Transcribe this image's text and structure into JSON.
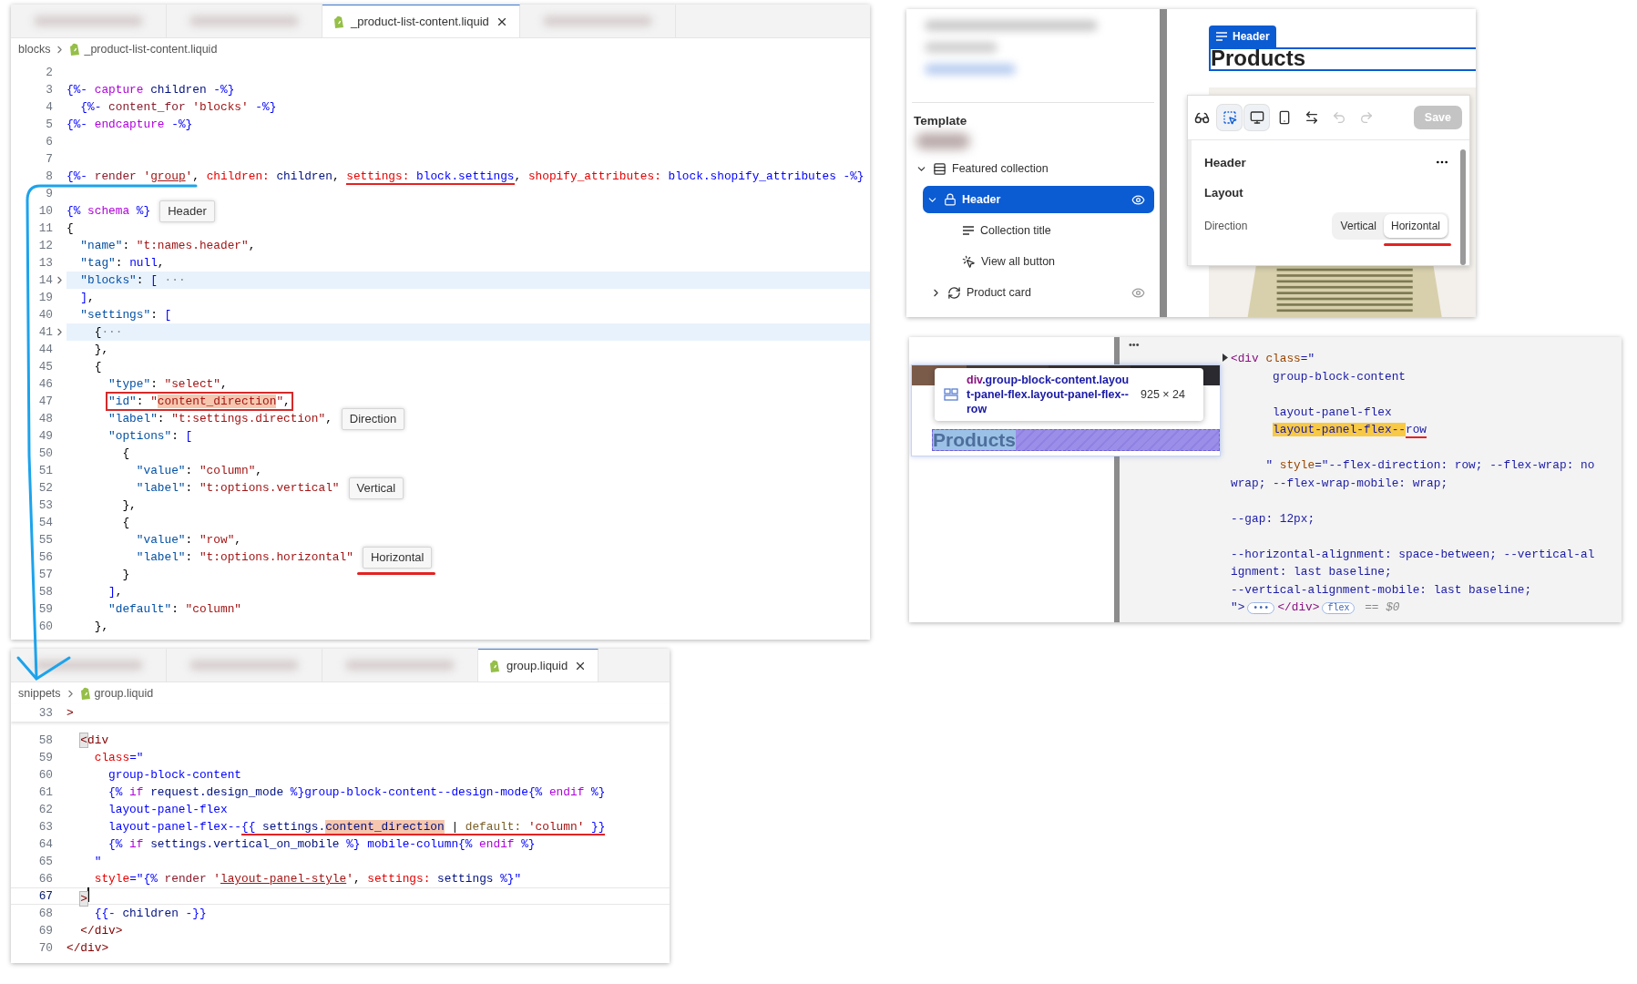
{
  "code_editors": [
    {
      "tabs": [
        {
          "kind": "blurred",
          "selected": false
        },
        {
          "kind": "blurred",
          "selected": false
        },
        {
          "kind": "file",
          "label": "_product-list-content.liquid",
          "selected": true
        },
        {
          "kind": "blurred",
          "selected": false
        }
      ],
      "breadcrumb": [
        "blocks",
        "_product-list-content.liquid"
      ],
      "lines": [
        {
          "n": "2"
        },
        {
          "n": "3",
          "tokens": [
            {
              "text": "{%-",
              "kind": "delimiter"
            },
            {
              "text": " capture",
              "kind": "keyword"
            },
            {
              "text": " children",
              "kind": "variable"
            },
            {
              "text": " -%}",
              "kind": "delimiter"
            }
          ]
        },
        {
          "n": "4",
          "tokens": [
            {
              "text": "  {%-",
              "kind": "delimiter"
            },
            {
              "text": " content_for",
              "kind": "tag"
            },
            {
              "text": " 'blocks'",
              "kind": "string"
            },
            {
              "text": " -%}",
              "kind": "delimiter"
            }
          ]
        },
        {
          "n": "5",
          "tokens": [
            {
              "text": "{%-",
              "kind": "delimiter"
            },
            {
              "text": " endcapture",
              "kind": "keyword"
            },
            {
              "text": " -%}",
              "kind": "delimiter"
            }
          ]
        },
        {
          "n": "6"
        },
        {
          "n": "7"
        },
        {
          "n": "8",
          "tokens": [
            {
              "text": "{%-",
              "kind": "delimiter"
            },
            {
              "text": " render ",
              "kind": "tag"
            },
            {
              "text": "'",
              "kind": "string"
            },
            {
              "text": "group",
              "kind": "string",
              "underlined": true
            },
            {
              "text": "'",
              "kind": "string"
            },
            {
              "text": ", ",
              "kind": "plain"
            },
            {
              "text": "children:",
              "kind": "attribute"
            },
            {
              "text": " children",
              "kind": "variable"
            },
            {
              "text": ", ",
              "kind": "plain"
            },
            {
              "text": "settings: ",
              "kind": "attribute",
              "annotated": true
            },
            {
              "text": "block.settings",
              "kind": "literal",
              "annotated": true
            },
            {
              "text": ", ",
              "kind": "plain"
            },
            {
              "text": "shopify_attributes:",
              "kind": "attribute"
            },
            {
              "text": " block.shopify_attributes",
              "kind": "literal"
            },
            {
              "text": " -%}",
              "kind": "delimiter"
            }
          ]
        },
        {
          "n": "9"
        },
        {
          "n": "10",
          "tokens": [
            {
              "text": "{%",
              "kind": "delimiter"
            },
            {
              "text": " schema",
              "kind": "keyword"
            },
            {
              "text": " %}",
              "kind": "delimiter"
            }
          ],
          "callout": {
            "text": "Header"
          }
        },
        {
          "n": "11",
          "tokens": [
            {
              "text": "{",
              "kind": "plain"
            }
          ]
        },
        {
          "n": "12",
          "tokens": [
            {
              "text": "  \"name\"",
              "kind": "key"
            },
            {
              "text": ": ",
              "kind": "plain"
            },
            {
              "text": "\"t:names.header\"",
              "kind": "string"
            },
            {
              "text": ",",
              "kind": "plain"
            }
          ]
        },
        {
          "n": "13",
          "tokens": [
            {
              "text": "  \"tag\"",
              "kind": "key"
            },
            {
              "text": ": ",
              "kind": "plain"
            },
            {
              "text": "null",
              "kind": "literal"
            },
            {
              "text": ",",
              "kind": "plain"
            }
          ]
        },
        {
          "n": "14",
          "folded": true,
          "tokens": [
            {
              "text": "  \"blocks\"",
              "kind": "key"
            },
            {
              "text": ": ",
              "kind": "plain"
            },
            {
              "text": "[",
              "kind": "literal"
            },
            {
              "text": " ···",
              "kind": "folded"
            }
          ]
        },
        {
          "n": "19",
          "tokens": [
            {
              "text": "  ]",
              "kind": "literal"
            },
            {
              "text": ",",
              "kind": "plain"
            }
          ]
        },
        {
          "n": "40",
          "tokens": [
            {
              "text": "  \"settings\"",
              "kind": "key"
            },
            {
              "text": ": ",
              "kind": "plain"
            },
            {
              "text": "[",
              "kind": "literal"
            }
          ]
        },
        {
          "n": "41",
          "folded": true,
          "tokens": [
            {
              "text": "    {",
              "kind": "plain"
            },
            {
              "text": "···",
              "kind": "folded"
            }
          ]
        },
        {
          "n": "44",
          "tokens": [
            {
              "text": "    },",
              "kind": "plain"
            }
          ]
        },
        {
          "n": "45",
          "tokens": [
            {
              "text": "    {",
              "kind": "plain"
            }
          ]
        },
        {
          "n": "46",
          "tokens": [
            {
              "text": "      \"type\"",
              "kind": "key"
            },
            {
              "text": ": ",
              "kind": "plain"
            },
            {
              "text": "\"select\"",
              "kind": "string"
            },
            {
              "text": ",",
              "kind": "plain"
            }
          ]
        },
        {
          "n": "47",
          "boxed": true,
          "tokens": [
            {
              "text": "      \"id\"",
              "kind": "key"
            },
            {
              "text": ": ",
              "kind": "plain"
            },
            {
              "text": "\"",
              "kind": "string"
            },
            {
              "text": "content_direction",
              "kind": "string",
              "highlighted": true
            },
            {
              "text": "\"",
              "kind": "string"
            },
            {
              "text": ",",
              "kind": "plain"
            }
          ]
        },
        {
          "n": "48",
          "tokens": [
            {
              "text": "      \"label\"",
              "kind": "key"
            },
            {
              "text": ": ",
              "kind": "plain"
            },
            {
              "text": "\"t:settings.direction\"",
              "kind": "string"
            },
            {
              "text": ",",
              "kind": "plain"
            }
          ],
          "callout": {
            "text": "Direction"
          }
        },
        {
          "n": "49",
          "tokens": [
            {
              "text": "      \"options\"",
              "kind": "key"
            },
            {
              "text": ": ",
              "kind": "plain"
            },
            {
              "text": "[",
              "kind": "literal"
            }
          ]
        },
        {
          "n": "50",
          "tokens": [
            {
              "text": "        {",
              "kind": "plain"
            }
          ]
        },
        {
          "n": "51",
          "tokens": [
            {
              "text": "          \"value\"",
              "kind": "key"
            },
            {
              "text": ": ",
              "kind": "plain"
            },
            {
              "text": "\"column\"",
              "kind": "string"
            },
            {
              "text": ",",
              "kind": "plain"
            }
          ]
        },
        {
          "n": "52",
          "tokens": [
            {
              "text": "          \"label\"",
              "kind": "key"
            },
            {
              "text": ": ",
              "kind": "plain"
            },
            {
              "text": "\"t:options.vertical\"",
              "kind": "string"
            }
          ],
          "callout": {
            "text": "Vertical"
          }
        },
        {
          "n": "53",
          "tokens": [
            {
              "text": "        },",
              "kind": "plain"
            }
          ]
        },
        {
          "n": "54",
          "tokens": [
            {
              "text": "        {",
              "kind": "plain"
            }
          ]
        },
        {
          "n": "55",
          "tokens": [
            {
              "text": "          \"value\"",
              "kind": "key"
            },
            {
              "text": ": ",
              "kind": "plain"
            },
            {
              "text": "\"row\"",
              "kind": "string"
            },
            {
              "text": ",",
              "kind": "plain"
            }
          ]
        },
        {
          "n": "56",
          "tokens": [
            {
              "text": "          \"label\"",
              "kind": "key"
            },
            {
              "text": ": ",
              "kind": "plain"
            },
            {
              "text": "\"t:options.horizontal\"",
              "kind": "string"
            }
          ],
          "callout": {
            "text": "Horizontal",
            "marked": true
          }
        },
        {
          "n": "57",
          "tokens": [
            {
              "text": "        }",
              "kind": "plain"
            }
          ]
        },
        {
          "n": "58",
          "tokens": [
            {
              "text": "      ]",
              "kind": "literal"
            },
            {
              "text": ",",
              "kind": "plain"
            }
          ]
        },
        {
          "n": "59",
          "tokens": [
            {
              "text": "      \"default\"",
              "kind": "key"
            },
            {
              "text": ": ",
              "kind": "plain"
            },
            {
              "text": "\"column\"",
              "kind": "string"
            }
          ]
        },
        {
          "n": "60",
          "tokens": [
            {
              "text": "    },",
              "kind": "plain"
            }
          ]
        }
      ]
    },
    {
      "tabs": [
        {
          "kind": "blurred",
          "selected": false
        },
        {
          "kind": "blurred",
          "selected": false
        },
        {
          "kind": "blurred",
          "selected": false
        },
        {
          "kind": "file",
          "label": "group.liquid",
          "selected": true
        }
      ],
      "breadcrumb": [
        "snippets",
        "group.liquid"
      ],
      "sticky_line": {
        "n": "33",
        "tokens": [
          {
            "text": ">",
            "kind": "element"
          }
        ]
      },
      "lines": [
        {
          "n": "58",
          "tokens": [
            {
              "text": "  <",
              "kind": "element",
              "bracket_match": true
            },
            {
              "text": "div",
              "kind": "element"
            }
          ]
        },
        {
          "n": "59",
          "tokens": [
            {
              "text": "    class",
              "kind": "attribute"
            },
            {
              "text": "=\"",
              "kind": "literal"
            }
          ]
        },
        {
          "n": "60",
          "tokens": [
            {
              "text": "      group-block-content",
              "kind": "literal"
            }
          ]
        },
        {
          "n": "61",
          "tokens": [
            {
              "text": "      {%",
              "kind": "delimiter"
            },
            {
              "text": " if",
              "kind": "keyword"
            },
            {
              "text": " request.design_mode",
              "kind": "variable"
            },
            {
              "text": " %}",
              "kind": "delimiter"
            },
            {
              "text": "group-block-content--design-mode",
              "kind": "literal"
            },
            {
              "text": "{%",
              "kind": "delimiter"
            },
            {
              "text": " endif",
              "kind": "keyword"
            },
            {
              "text": " %}",
              "kind": "delimiter"
            }
          ]
        },
        {
          "n": "62",
          "tokens": [
            {
              "text": "      layout-panel-flex",
              "kind": "literal"
            }
          ]
        },
        {
          "n": "63",
          "tokens": [
            {
              "text": "      layout-panel-flex--",
              "kind": "literal"
            },
            {
              "text": "{{",
              "kind": "delimiter",
              "annotated": true
            },
            {
              "text": " settings.",
              "kind": "variable",
              "annotated": true
            },
            {
              "text": "content_direction",
              "kind": "variable",
              "annotated": true,
              "highlighted": true
            },
            {
              "text": " | ",
              "kind": "plain",
              "annotated": true
            },
            {
              "text": "default:",
              "kind": "filter",
              "annotated": true
            },
            {
              "text": " 'column'",
              "kind": "string",
              "annotated": true
            },
            {
              "text": " }}",
              "kind": "delimiter",
              "annotated": true
            }
          ]
        },
        {
          "n": "64",
          "tokens": [
            {
              "text": "      {%",
              "kind": "delimiter"
            },
            {
              "text": " if",
              "kind": "keyword"
            },
            {
              "text": " settings.vertical_on_mobile",
              "kind": "variable"
            },
            {
              "text": " %}",
              "kind": "delimiter"
            },
            {
              "text": " mobile-column",
              "kind": "literal"
            },
            {
              "text": "{%",
              "kind": "delimiter"
            },
            {
              "text": " endif",
              "kind": "keyword"
            },
            {
              "text": " %}",
              "kind": "delimiter"
            }
          ]
        },
        {
          "n": "65",
          "tokens": [
            {
              "text": "    \"",
              "kind": "literal"
            }
          ]
        },
        {
          "n": "66",
          "tokens": [
            {
              "text": "    style",
              "kind": "attribute"
            },
            {
              "text": "=\"",
              "kind": "literal"
            },
            {
              "text": "{%",
              "kind": "delimiter"
            },
            {
              "text": " render ",
              "kind": "tag"
            },
            {
              "text": "'",
              "kind": "string"
            },
            {
              "text": "layout-panel-style",
              "kind": "string",
              "underlined": true
            },
            {
              "text": "'",
              "kind": "string"
            },
            {
              "text": ", ",
              "kind": "plain"
            },
            {
              "text": "settings:",
              "kind": "attribute"
            },
            {
              "text": " settings",
              "kind": "variable"
            },
            {
              "text": " %}",
              "kind": "delimiter"
            },
            {
              "text": "\"",
              "kind": "literal"
            }
          ]
        },
        {
          "n": "67",
          "current": true,
          "tokens": [
            {
              "text": "  >",
              "kind": "element",
              "bracket_match": true
            }
          ]
        },
        {
          "n": "68",
          "tokens": [
            {
              "text": "    {{-",
              "kind": "delimiter"
            },
            {
              "text": " children",
              "kind": "variable"
            },
            {
              "text": " -}}",
              "kind": "delimiter"
            }
          ]
        },
        {
          "n": "69",
          "tokens": [
            {
              "text": "  </div>",
              "kind": "element"
            }
          ]
        },
        {
          "n": "70",
          "tokens": [
            {
              "text": "</div>",
              "kind": "element"
            }
          ]
        }
      ]
    }
  ],
  "theme_editor": {
    "sidebar": {
      "section_title": "Template",
      "layers": [
        {
          "label": "Featured collection",
          "kind": "section",
          "selected": false,
          "expanded": true,
          "visibility_toggle": false,
          "children": [
            {
              "label": "Header",
              "kind": "group",
              "selected": true,
              "expanded": true,
              "visibility_toggle": true,
              "children": [
                {
                  "label": "Collection title",
                  "kind": "text",
                  "selected": false,
                  "visibility_toggle": false
                },
                {
                  "label": "View all button",
                  "kind": "button",
                  "selected": false,
                  "visibility_toggle": false
                }
              ]
            },
            {
              "label": "Product card",
              "kind": "card",
              "selected": false,
              "expanded": false,
              "visibility_toggle": true
            }
          ]
        }
      ]
    },
    "preview": {
      "block_badge": "Header",
      "heading": "Products"
    },
    "toolbar": {
      "tools": [
        {
          "kind": "inspector",
          "selected": false,
          "disabled": false
        },
        {
          "kind": "select",
          "selected": true,
          "disabled": false
        },
        {
          "kind": "desktop",
          "selected": true,
          "disabled": false
        },
        {
          "kind": "mobile",
          "selected": false,
          "disabled": false
        },
        {
          "kind": "fullwidth",
          "selected": false,
          "disabled": false
        },
        {
          "kind": "undo",
          "selected": false,
          "disabled": true
        },
        {
          "kind": "redo",
          "selected": false,
          "disabled": true
        }
      ],
      "save": {
        "label": "Save",
        "disabled": true
      }
    },
    "settings": {
      "title": "Header",
      "group": "Layout",
      "field": {
        "label": "Direction",
        "options": [
          {
            "label": "Vertical",
            "selected": false,
            "marked": false
          },
          {
            "label": "Horizontal",
            "selected": true,
            "marked": true
          }
        ]
      }
    }
  },
  "devtools": {
    "tooltip": {
      "tag": "div",
      "classes": ".group-block-content.layout-panel-flex.layout-panel-flex--row",
      "size": "925 × 24"
    },
    "highlighted_text": "Products",
    "more_button": "•••",
    "lines": [
      {
        "expander": true,
        "tokens": [
          {
            "text": "<div",
            "kind": "tag"
          },
          {
            "text": " class",
            "kind": "attribute"
          },
          {
            "text": "=\"",
            "kind": "value"
          }
        ]
      },
      {
        "blank_after": true,
        "tokens": [
          {
            "text": "      group-block-content",
            "kind": "value"
          }
        ]
      },
      {
        "tokens": [
          {
            "text": "      layout-panel-flex",
            "kind": "value"
          }
        ]
      },
      {
        "blank_after": true,
        "tokens": [
          {
            "text": "      layout-panel-flex--",
            "kind": "value",
            "highlighted": true
          },
          {
            "text": "row",
            "kind": "value",
            "annotated": true
          }
        ]
      },
      {
        "blank_after": true,
        "tokens": [
          {
            "text": "     \" ",
            "kind": "value"
          },
          {
            "text": "style",
            "kind": "attribute"
          },
          {
            "text": "=\"--flex-direction: row; --flex-wrap: nowrap; --flex-wrap-mobile: wrap;",
            "kind": "value"
          }
        ]
      },
      {
        "blank_after": true,
        "tokens": [
          {
            "text": "--gap: 12px;",
            "kind": "value"
          }
        ]
      },
      {
        "tokens": [
          {
            "text": "--horizontal-alignment: space-between; --vertical-alignment: last baseline;",
            "kind": "value"
          }
        ]
      },
      {
        "tokens": [
          {
            "text": "--vertical-alignment-mobile: last baseline;",
            "kind": "value"
          }
        ]
      },
      {
        "tokens": [
          {
            "text": "\">",
            "kind": "value"
          },
          {
            "text": "•••",
            "kind": "pill"
          },
          {
            "text": "</div>",
            "kind": "tag"
          },
          {
            "text": "flex",
            "kind": "pill"
          },
          {
            "text": " == $0",
            "kind": "console"
          }
        ]
      }
    ]
  }
}
